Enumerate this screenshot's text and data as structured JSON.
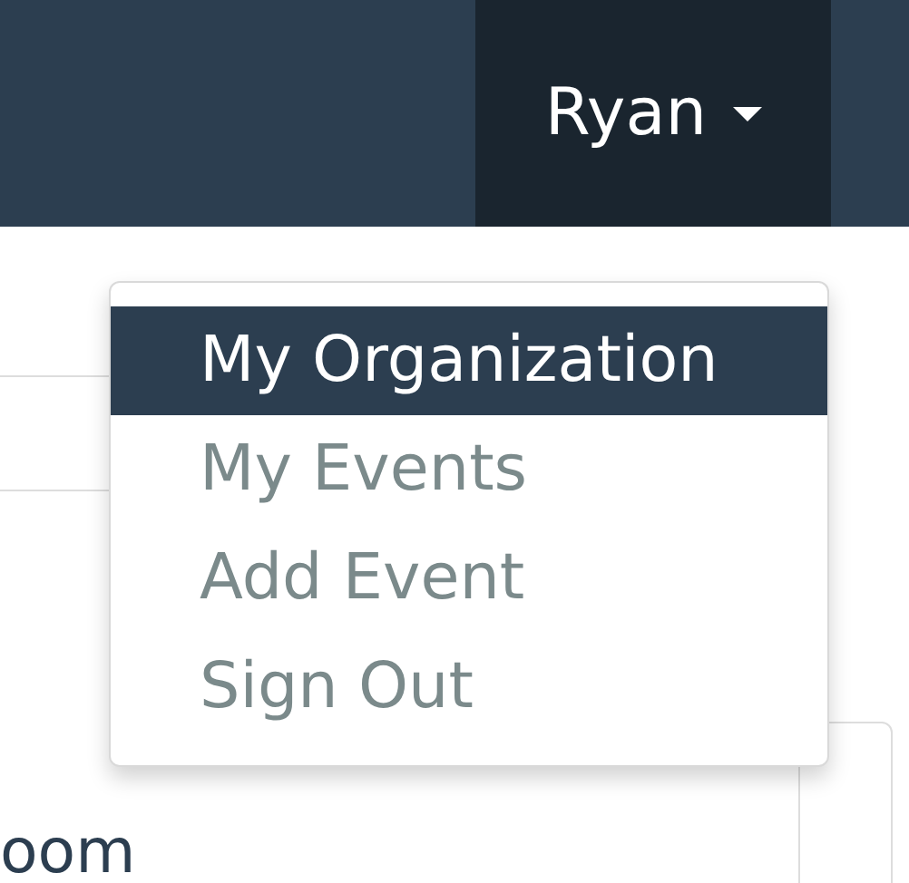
{
  "navbar": {
    "user_menu": {
      "label": "Ryan",
      "expanded": true
    }
  },
  "dropdown": {
    "items": [
      {
        "label": "My Organization",
        "selected": true
      },
      {
        "label": "My Events",
        "selected": false
      },
      {
        "label": "Add Event",
        "selected": false
      },
      {
        "label": "Sign Out",
        "selected": false
      }
    ]
  },
  "content": {
    "partial_text": "oom"
  }
}
